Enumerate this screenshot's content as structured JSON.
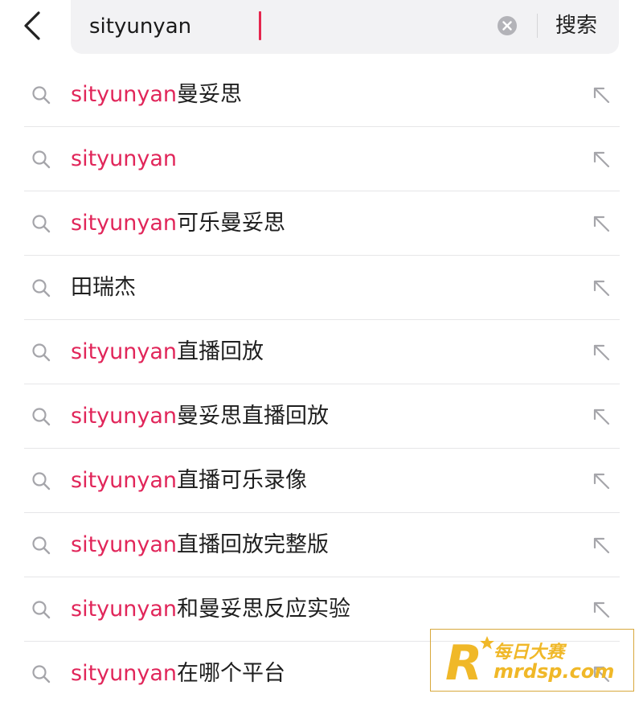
{
  "search": {
    "query": "sityunyan",
    "submit_label": "搜索"
  },
  "suggestions": [
    {
      "highlight": "sityunyan",
      "rest": "曼妥思"
    },
    {
      "highlight": "sityunyan",
      "rest": ""
    },
    {
      "highlight": "sityunyan",
      "rest": "可乐曼妥思"
    },
    {
      "highlight": "",
      "rest": "田瑞杰"
    },
    {
      "highlight": "sityunyan",
      "rest": "直播回放"
    },
    {
      "highlight": "sityunyan",
      "rest": "曼妥思直播回放"
    },
    {
      "highlight": "sityunyan",
      "rest": "直播可乐录像"
    },
    {
      "highlight": "sityunyan",
      "rest": "直播回放完整版"
    },
    {
      "highlight": "sityunyan",
      "rest": "和曼妥思反应实验"
    },
    {
      "highlight": "sityunyan",
      "rest": "在哪个平台"
    }
  ],
  "icons": {
    "back": "chevron-left-icon",
    "clear": "clear-icon",
    "suggestion": "search-icon",
    "fill": "arrow-up-left-icon"
  },
  "watermark": {
    "line1": "每日大赛",
    "line2": "mrdsp.com",
    "logo_letter": "R"
  },
  "colors": {
    "highlight": "#e1265a",
    "caret": "#e5264e",
    "search_bg": "#f2f2f4",
    "watermark": "#f0b828"
  }
}
